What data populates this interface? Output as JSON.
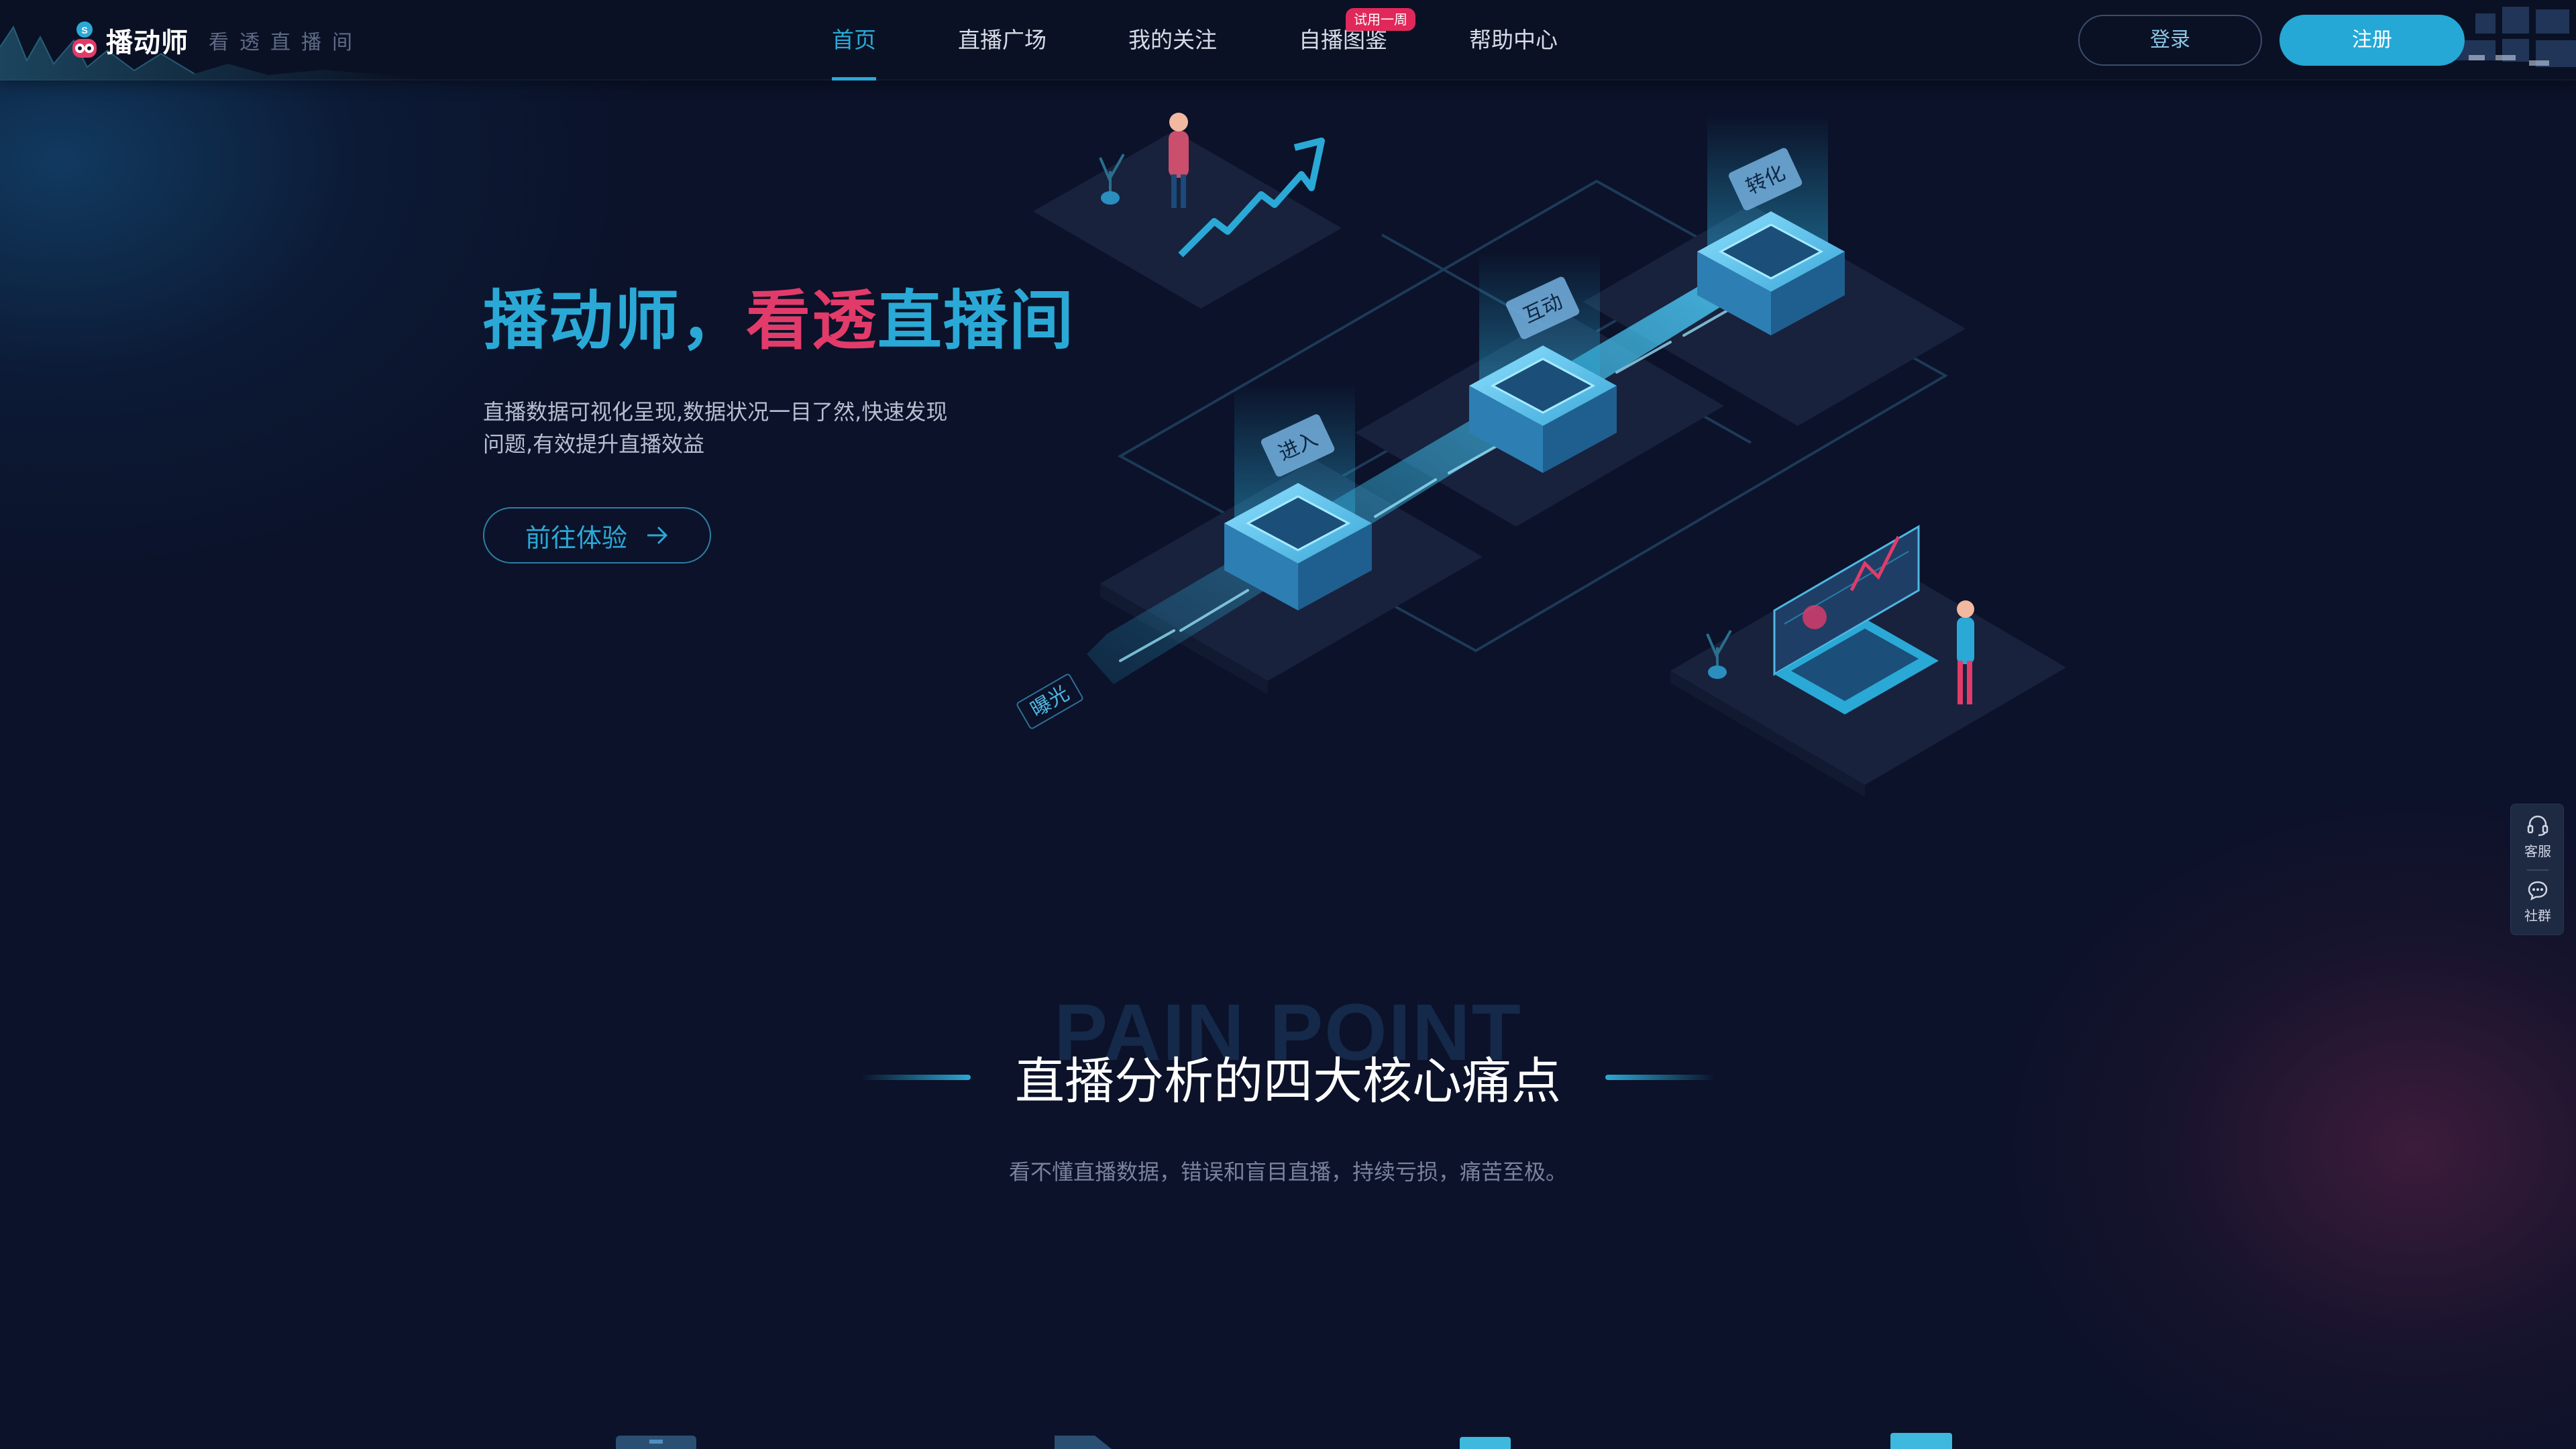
{
  "header": {
    "logo_text": "播动师",
    "slogan": "看透直播间",
    "nav": [
      {
        "label": "首页",
        "active": true
      },
      {
        "label": "直播广场",
        "active": false
      },
      {
        "label": "我的关注",
        "active": false
      },
      {
        "label": "自播图鉴",
        "active": false,
        "badge": "试用一周"
      },
      {
        "label": "帮助中心",
        "active": false
      }
    ],
    "login_label": "登录",
    "register_label": "注册"
  },
  "hero": {
    "title_part1": "播动师，",
    "title_part2": "看透",
    "title_part3": "直播间",
    "description": "直播数据可视化呈现,数据状况一目了然,快速发现问题,有效提升直播效益",
    "cta_label": "前往体验",
    "illustration": {
      "stages": [
        "曝光",
        "进入",
        "互动",
        "转化"
      ]
    }
  },
  "pain_section": {
    "bg_word": "PAIN POINT",
    "title": "直播分析的四大核心痛点",
    "subtitle": "看不懂直播数据，错误和盲目直播，持续亏损，痛苦至极。"
  },
  "float_panel": {
    "service_label": "客服",
    "community_label": "社群"
  },
  "colors": {
    "accent": "#2aa9d6",
    "highlight": "#e23b6a",
    "background": "#0b1229",
    "badge": "#e0285a"
  }
}
